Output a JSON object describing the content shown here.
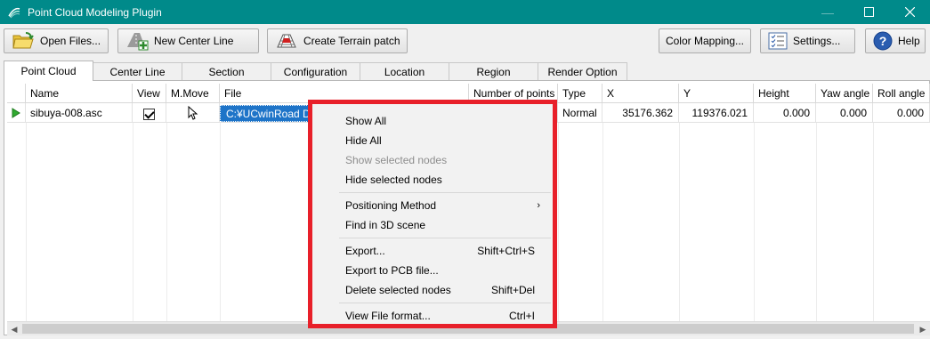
{
  "window": {
    "title": "Point Cloud Modeling Plugin"
  },
  "toolbar": {
    "open_files": "Open Files...",
    "new_center_line": "New Center Line",
    "create_terrain_patch": "Create Terrain patch",
    "color_mapping": "Color Mapping...",
    "settings": "Settings...",
    "help": "Help"
  },
  "tabs": [
    "Point Cloud",
    "Center Line",
    "Section",
    "Configuration",
    "Location",
    "Region",
    "Render Option"
  ],
  "grid": {
    "columns": [
      "Name",
      "View",
      "M.Move",
      "File",
      "Number of points",
      "Type",
      "X",
      "Y",
      "Height",
      "Yaw angle",
      "Roll angle"
    ],
    "rows": [
      {
        "name": "sibuya-008.asc",
        "view_checked": true,
        "file": "C:¥UCwinRoad Dat",
        "type": "Normal",
        "x": "35176.362",
        "y": "119376.021",
        "height": "0.000",
        "yaw": "0.000",
        "roll": "0.000"
      }
    ]
  },
  "context_menu": {
    "show_all": "Show All",
    "hide_all": "Hide All",
    "show_selected_nodes": "Show selected nodes",
    "hide_selected_nodes": "Hide selected nodes",
    "positioning_method": "Positioning Method",
    "find_in_3d_scene": "Find in 3D scene",
    "export": "Export...",
    "export_shortcut": "Shift+Ctrl+S",
    "export_pcb": "Export to PCB file...",
    "delete_selected_nodes": "Delete selected nodes",
    "delete_shortcut": "Shift+Del",
    "view_file_format": "View File format...",
    "view_file_format_shortcut": "Ctrl+I"
  },
  "colors": {
    "titlebar": "#008a8a",
    "highlight_border": "#e8202a",
    "selection": "#1e74c8"
  }
}
